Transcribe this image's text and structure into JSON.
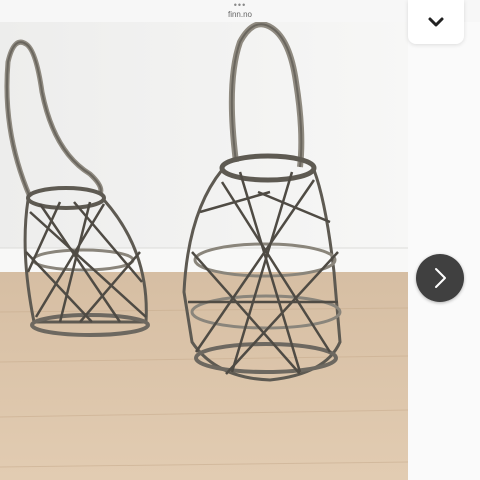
{
  "browser": {
    "dots": "•••",
    "domain": "finn.no"
  },
  "icons": {
    "collapse": "chevron-down-icon",
    "next": "chevron-right-icon"
  },
  "colors": {
    "wall": "#f2f2f0",
    "floor": "#d8c0a4",
    "basket": "#5e5a52",
    "button_dark": "#404040"
  }
}
